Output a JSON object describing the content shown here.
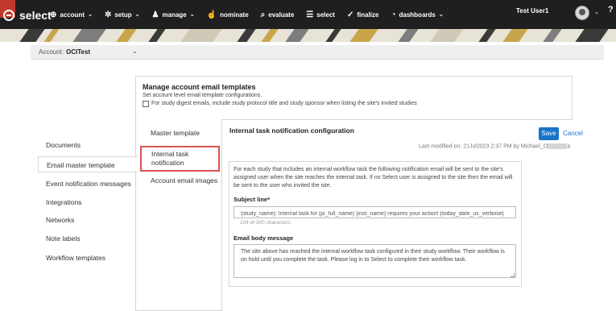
{
  "header": {
    "app_name": "select",
    "nav": [
      {
        "label": "account",
        "icon": "globe-icon",
        "glyph": "⊕",
        "dropdown": true
      },
      {
        "label": "setup",
        "icon": "gear-icon",
        "glyph": "✲",
        "dropdown": true
      },
      {
        "label": "manage",
        "icon": "user-icon",
        "glyph": "♟",
        "dropdown": true
      },
      {
        "label": "nominate",
        "icon": "thumbs-up-icon",
        "glyph": "☝",
        "dropdown": false
      },
      {
        "label": "evaluate",
        "icon": "search-icon",
        "glyph": "⌕",
        "dropdown": false
      },
      {
        "label": "select",
        "icon": "list-icon",
        "glyph": "☰",
        "dropdown": false
      },
      {
        "label": "finalize",
        "icon": "check-circle-icon",
        "glyph": "✓",
        "dropdown": false
      },
      {
        "label": "dashboards",
        "icon": "pie-chart-icon",
        "glyph": "◔",
        "dropdown": true
      }
    ],
    "user_name": "Test User1",
    "help": "?",
    "chevron": "⌄"
  },
  "account_strip": {
    "label": "Account:",
    "value": "OCITest",
    "chevron": "⌄"
  },
  "manage": {
    "title": "Manage account email templates",
    "subtitle": "Set account level email template configurations.",
    "digest_checkbox_label": "For study digest emails, include study protocol title and study sponsor when listing the site's invited studies"
  },
  "left_sidebar": {
    "items": [
      {
        "label": "Documents",
        "active": false
      },
      {
        "label": "Email master template",
        "active": true
      },
      {
        "label": "Event notification messages",
        "active": false
      },
      {
        "label": "Integrations",
        "active": false
      },
      {
        "label": "Networks",
        "active": false
      },
      {
        "label": "Note labels",
        "active": false
      },
      {
        "label": "Workflow templates",
        "active": false
      }
    ]
  },
  "template_list": {
    "items": [
      {
        "label": "Master template"
      },
      {
        "label": "Internal task notification"
      },
      {
        "label": "Account email images"
      }
    ]
  },
  "config": {
    "title": "Internal task notification configuration",
    "save_label": "Save",
    "cancel_label": "Cancel",
    "last_modified_prefix": "Last modified on: 21Jul2023 2:37 PM by Michael_O",
    "last_modified_suffix": "a",
    "intro": "For each study that includes an internal workflow task the following notification email will be sent to the site's assigned user when the site reaches the internal task. If no Select user is assigned to the site then the email will be sent to the user who invited the site.",
    "subject_label": "Subject line*",
    "subject_value": "{study_name}: Internal task for {pi_full_name} {inst_name} requires your action! {today_date_us_verbose}",
    "char_count": "104 of 300 characters",
    "body_label": "Email body message",
    "body_value": "The site above has reached the internal workflow task configured in their study workflow. Their workflow is on hold until you complete the task. Please log in to Select to complete their workflow task."
  },
  "colors": {
    "topbar": "#1f1f1f",
    "brand_red": "#c0392b",
    "accent_blue": "#1a73c9",
    "highlight_red": "#d9534f"
  }
}
